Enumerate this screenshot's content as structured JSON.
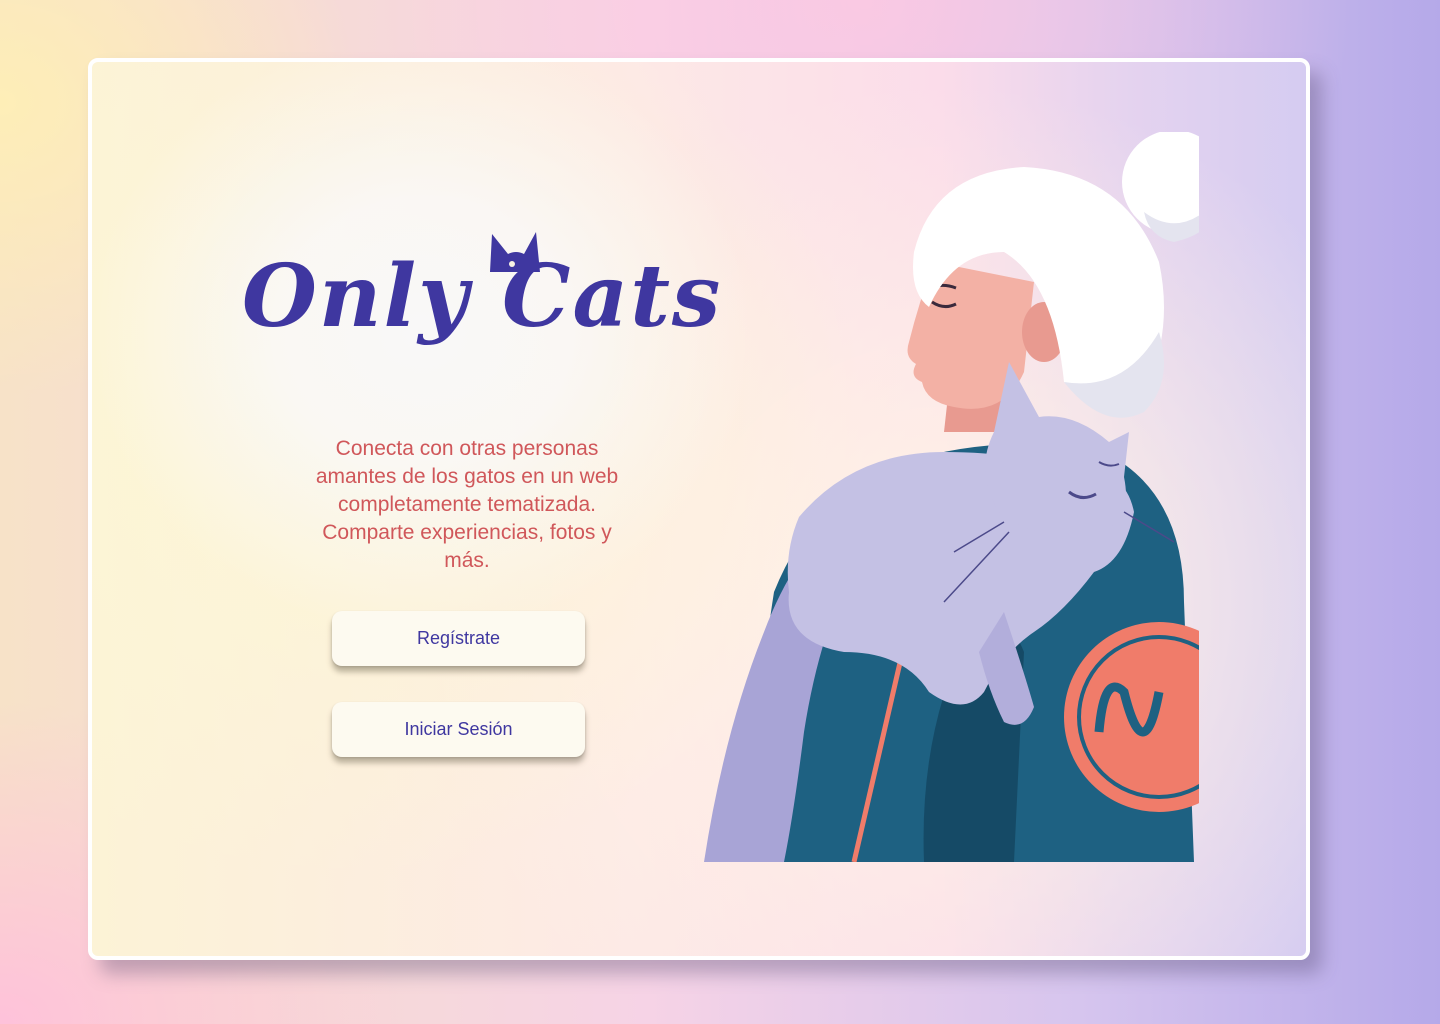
{
  "app": {
    "logo_text": "Only Cats"
  },
  "hero": {
    "tagline": "Conecta con otras personas amantes de los gatos en un web completamente tematizada. Comparte experiencias, fotos y más."
  },
  "actions": {
    "register_label": "Regístrate",
    "login_label": "Iniciar Sesión"
  },
  "colors": {
    "brand": "#3f37a0",
    "tagline": "#d0575a",
    "button_bg": "#fdfaf0"
  },
  "illustration": {
    "icon": "woman-with-cat-illustration"
  }
}
